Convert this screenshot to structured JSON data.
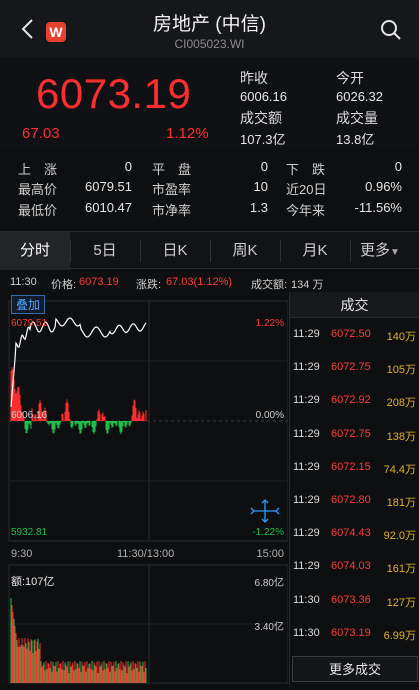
{
  "header": {
    "logo_letter": "W",
    "title": "房地产 (中信)",
    "code": "CI005023.WI"
  },
  "quote": {
    "price": "6073.19",
    "change": "67.03",
    "change_pct": "1.12%",
    "prev_close_label": "昨收",
    "prev_close": "6006.16",
    "open_label": "今开",
    "open": "6026.32",
    "turnover_label": "成交额",
    "turnover": "107.3亿",
    "volume_label": "成交量",
    "volume": "13.8亿"
  },
  "stats": {
    "rows": [
      [
        {
          "l": "上　涨",
          "v": "0"
        },
        {
          "l": "平　盘",
          "v": "0"
        },
        {
          "l": "下　跌",
          "v": "0"
        }
      ],
      [
        {
          "l": "最高价",
          "v": "6079.51"
        },
        {
          "l": "市盈率",
          "v": "10"
        },
        {
          "l": "近20日",
          "v": "0.96%"
        }
      ],
      [
        {
          "l": "最低价",
          "v": "6010.47"
        },
        {
          "l": "市净率",
          "v": "1.3"
        },
        {
          "l": "今年来",
          "v": "-11.56%"
        }
      ]
    ]
  },
  "tabs": [
    "分时",
    "5日",
    "日K",
    "周K",
    "月K",
    "更多"
  ],
  "info": {
    "time": "11:30",
    "price_label": "价格:",
    "price": "6073.19",
    "chg_label": "涨跌:",
    "chg": "67.03(1.12%)",
    "amt_label": "成交额:",
    "amt": "134 万"
  },
  "chart": {
    "overlay_label": "叠加",
    "y_top": "6079.51",
    "y_mid": "6006.16",
    "y_bot": "5932.81",
    "pct_top": "1.22%",
    "pct_mid": "0.00%",
    "pct_bot": "-1.22%",
    "x_start": "9:30",
    "x_mid": "11:30/13:00",
    "x_end": "15:00",
    "vol_label": "额:107亿",
    "vol_top": "6.80亿",
    "vol_mid": "3.40亿",
    "colors": {
      "up": "#ff2e2e",
      "down": "#1fbf4a",
      "line": "#ffffff",
      "accent": "#2f9bff"
    }
  },
  "trades": {
    "title": "成交",
    "rows": [
      {
        "t": "11:29",
        "p": "6072.50",
        "v": "140万"
      },
      {
        "t": "11:29",
        "p": "6072.75",
        "v": "105万"
      },
      {
        "t": "11:29",
        "p": "6072.92",
        "v": "208万"
      },
      {
        "t": "11:29",
        "p": "6072.75",
        "v": "138万"
      },
      {
        "t": "11:29",
        "p": "6072.15",
        "v": "74.4万"
      },
      {
        "t": "11:29",
        "p": "6072.80",
        "v": "181万"
      },
      {
        "t": "11:29",
        "p": "6074.43",
        "v": "92.0万"
      },
      {
        "t": "11:29",
        "p": "6074.03",
        "v": "161万"
      },
      {
        "t": "11:30",
        "p": "6073.36",
        "v": "127万"
      },
      {
        "t": "11:30",
        "p": "6073.19",
        "v": "6.99万"
      }
    ],
    "more_label": "更多成交"
  }
}
